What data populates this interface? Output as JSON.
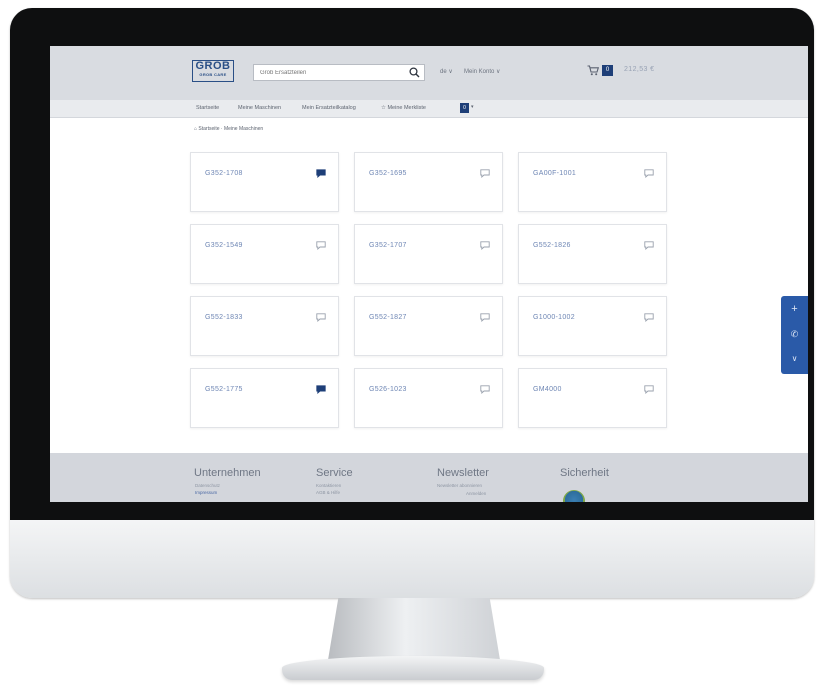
{
  "header": {
    "logo_brand": "GROB",
    "logo_sub": "GROB CARE",
    "search_placeholder": "Grob Ersatzteilen",
    "lang": "de ∨",
    "account": "Mein Konto ∨",
    "cart_count": "0",
    "cart_total": "212,53 €"
  },
  "nav": {
    "items": [
      {
        "label": "Startseite"
      },
      {
        "label": "Meine Maschinen"
      },
      {
        "label": "Mein Ersatzteilkatalog"
      },
      {
        "label": "☆  Meine Merkliste"
      }
    ],
    "watchlist_count": "0"
  },
  "breadcrumb": "⌂ Startseite · Meine Maschinen",
  "machines": [
    {
      "id": "G352-1708",
      "has_messages": true
    },
    {
      "id": "G352-1695",
      "has_messages": false
    },
    {
      "id": "GA00F-1001",
      "has_messages": false
    },
    {
      "id": "G352-1549",
      "has_messages": false
    },
    {
      "id": "G352-1707",
      "has_messages": false
    },
    {
      "id": "G552-1826",
      "has_messages": false
    },
    {
      "id": "G552-1833",
      "has_messages": false
    },
    {
      "id": "G552-1827",
      "has_messages": false
    },
    {
      "id": "G1000-1002",
      "has_messages": false
    },
    {
      "id": "G552-1775",
      "has_messages": true
    },
    {
      "id": "G526-1023",
      "has_messages": false
    },
    {
      "id": "GM4000",
      "has_messages": false
    }
  ],
  "side_actions": {
    "add": "+",
    "phone": "✆",
    "collapse": "∨"
  },
  "footer": {
    "company": {
      "title": "Unternehmen",
      "line1": "Datenschutz",
      "line2": "Impressum"
    },
    "service": {
      "title": "Service",
      "line1": "Kontaktieren",
      "line2": "AGB & Hilfe"
    },
    "newsletter": {
      "title": "Newsletter",
      "line1": "Newsletter abonnieren",
      "line2": "Anmelden"
    },
    "security": {
      "title": "Sicherheit"
    }
  },
  "colors": {
    "brand": "#2a4f86",
    "accent": "#2a5aa8",
    "message_active": "#1e3f78",
    "message_inactive": "#9aa1ad"
  }
}
